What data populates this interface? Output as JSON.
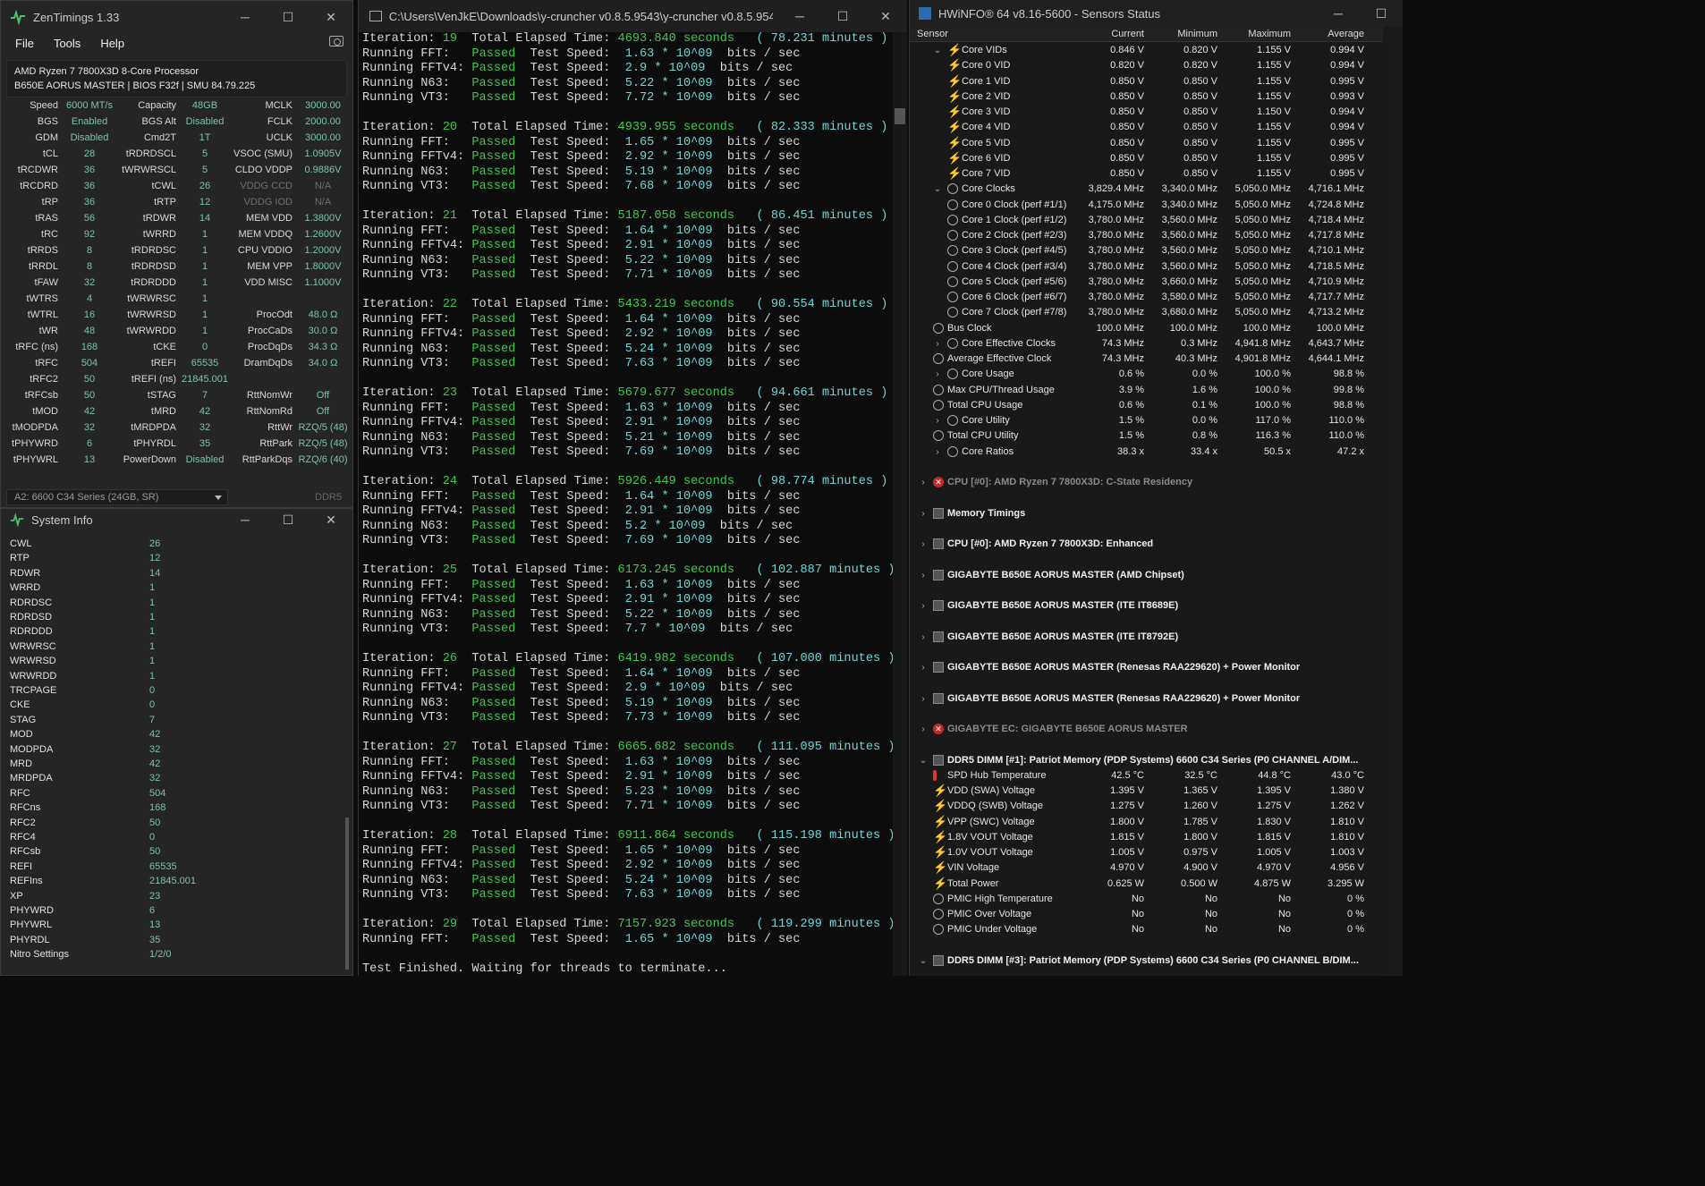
{
  "zentimings": {
    "title": "ZenTimings 1.33",
    "menu": [
      "File",
      "Tools",
      "Help"
    ],
    "cpu_name": "AMD Ryzen 7 7800X3D 8-Core Processor",
    "board": "B650E AORUS MASTER | BIOS F32f | SMU 84.79.225",
    "rows": [
      [
        [
          "Speed",
          "6000 MT/s"
        ],
        [
          "Capacity",
          "48GB"
        ],
        [
          "MCLK",
          "3000.00"
        ]
      ],
      [
        [
          "BGS",
          "Enabled"
        ],
        [
          "BGS Alt",
          "Disabled"
        ],
        [
          "FCLK",
          "2000.00"
        ]
      ],
      [
        [
          "GDM",
          "Disabled"
        ],
        [
          "Cmd2T",
          "1T"
        ],
        [
          "UCLK",
          "3000.00"
        ]
      ],
      [
        [
          "tCL",
          "28"
        ],
        [
          "tRDRDSCL",
          "5"
        ],
        [
          "VSOC (SMU)",
          "1.0905V"
        ]
      ],
      [
        [
          "tRCDWR",
          "36"
        ],
        [
          "tWRWRSCL",
          "5"
        ],
        [
          "CLDO VDDP",
          "0.9886V"
        ]
      ],
      [
        [
          "tRCDRD",
          "36"
        ],
        [
          "tCWL",
          "26"
        ],
        [
          "VDDG CCD",
          "N/A"
        ]
      ],
      [
        [
          "tRP",
          "36"
        ],
        [
          "tRTP",
          "12"
        ],
        [
          "VDDG IOD",
          "N/A"
        ]
      ],
      [
        [
          "tRAS",
          "56"
        ],
        [
          "tRDWR",
          "14"
        ],
        [
          "MEM VDD",
          "1.3800V"
        ]
      ],
      [
        [
          "tRC",
          "92"
        ],
        [
          "tWRRD",
          "1"
        ],
        [
          "MEM VDDQ",
          "1.2600V"
        ]
      ],
      [
        [
          "tRRDS",
          "8"
        ],
        [
          "tRDRDSC",
          "1"
        ],
        [
          "CPU VDDIO",
          "1.2000V"
        ]
      ],
      [
        [
          "tRRDL",
          "8"
        ],
        [
          "tRDRDSD",
          "1"
        ],
        [
          "MEM VPP",
          "1.8000V"
        ]
      ],
      [
        [
          "tFAW",
          "32"
        ],
        [
          "tRDRDDD",
          "1"
        ],
        [
          "VDD MISC",
          "1.1000V"
        ]
      ],
      [
        [
          "tWTRS",
          "4"
        ],
        [
          "tWRWRSC",
          "1"
        ],
        [
          "",
          ""
        ]
      ],
      [
        [
          "tWTRL",
          "16"
        ],
        [
          "tWRWRSD",
          "1"
        ],
        [
          "ProcOdt",
          "48.0 Ω"
        ]
      ],
      [
        [
          "tWR",
          "48"
        ],
        [
          "tWRWRDD",
          "1"
        ],
        [
          "ProcCaDs",
          "30.0 Ω"
        ]
      ],
      [
        [
          "tRFC (ns)",
          "168"
        ],
        [
          "tCKE",
          "0"
        ],
        [
          "ProcDqDs",
          "34.3 Ω"
        ]
      ],
      [
        [
          "tRFC",
          "504"
        ],
        [
          "tREFI",
          "65535"
        ],
        [
          "DramDqDs",
          "34.0 Ω"
        ]
      ],
      [
        [
          "tRFC2",
          "50"
        ],
        [
          "tREFI (ns)",
          "21845.001"
        ],
        [
          "",
          ""
        ]
      ],
      [
        [
          "tRFCsb",
          "50"
        ],
        [
          "tSTAG",
          "7"
        ],
        [
          "RttNomWr",
          "Off"
        ]
      ],
      [
        [
          "tMOD",
          "42"
        ],
        [
          "tMRD",
          "42"
        ],
        [
          "RttNomRd",
          "Off"
        ]
      ],
      [
        [
          "tMODPDA",
          "32"
        ],
        [
          "tMRDPDA",
          "32"
        ],
        [
          "RttWr",
          "RZQ/5 (48)"
        ]
      ],
      [
        [
          "tPHYWRD",
          "6"
        ],
        [
          "tPHYRDL",
          "35"
        ],
        [
          "RttPark",
          "RZQ/5 (48)"
        ]
      ],
      [
        [
          "tPHYWRL",
          "13"
        ],
        [
          "PowerDown",
          "Disabled"
        ],
        [
          "RttParkDqs",
          "RZQ/6 (40)"
        ]
      ]
    ],
    "dimm_select": "A2: 6600 C34 Series (24GB, SR)",
    "ddr_label": "DDR5"
  },
  "sysinfo": {
    "title": "System Info",
    "rows": [
      [
        "CWL",
        "26"
      ],
      [
        "RTP",
        "12"
      ],
      [
        "RDWR",
        "14"
      ],
      [
        "WRRD",
        "1"
      ],
      [
        "RDRDSC",
        "1"
      ],
      [
        "RDRDSD",
        "1"
      ],
      [
        "RDRDDD",
        "1"
      ],
      [
        "WRWRSC",
        "1"
      ],
      [
        "WRWRSD",
        "1"
      ],
      [
        "WRWRDD",
        "1"
      ],
      [
        "TRCPAGE",
        "0"
      ],
      [
        "CKE",
        "0"
      ],
      [
        "STAG",
        "7"
      ],
      [
        "MOD",
        "42"
      ],
      [
        "MODPDA",
        "32"
      ],
      [
        "MRD",
        "42"
      ],
      [
        "MRDPDA",
        "32"
      ],
      [
        "RFC",
        "504"
      ],
      [
        "RFCns",
        "168"
      ],
      [
        "RFC2",
        "50"
      ],
      [
        "RFC4",
        "0"
      ],
      [
        "RFCsb",
        "50"
      ],
      [
        "REFI",
        "65535"
      ],
      [
        "REFIns",
        "21845.001"
      ],
      [
        "XP",
        "23"
      ],
      [
        "PHYWRD",
        "6"
      ],
      [
        "PHYWRL",
        "13"
      ],
      [
        "PHYRDL",
        "35"
      ],
      [
        "Nitro Settings",
        "1/2/0"
      ]
    ]
  },
  "console": {
    "title": "C:\\Users\\VenJkE\\Downloads\\y-cruncher v0.8.5.9543\\y-cruncher v0.8.5.9543\\y-c...",
    "first_iteration": {
      "n": "19",
      "secs": "4693.840",
      "mins": "78.231",
      "speeds": [
        "1.63",
        "2.9",
        "5.22",
        "7.72"
      ]
    },
    "iterations": [
      {
        "n": "20",
        "secs": "4939.955",
        "mins": "82.333",
        "speeds": [
          "1.65",
          "2.92",
          "5.19",
          "7.68"
        ]
      },
      {
        "n": "21",
        "secs": "5187.058",
        "mins": "86.451",
        "speeds": [
          "1.64",
          "2.91",
          "5.22",
          "7.71"
        ]
      },
      {
        "n": "22",
        "secs": "5433.219",
        "mins": "90.554",
        "speeds": [
          "1.64",
          "2.92",
          "5.24",
          "7.63"
        ]
      },
      {
        "n": "23",
        "secs": "5679.677",
        "mins": "94.661",
        "speeds": [
          "1.63",
          "2.91",
          "5.21",
          "7.69"
        ]
      },
      {
        "n": "24",
        "secs": "5926.449",
        "mins": "98.774",
        "speeds": [
          "1.64",
          "2.91",
          "5.2",
          "7.69"
        ]
      },
      {
        "n": "25",
        "secs": "6173.245",
        "mins": "102.887",
        "speeds": [
          "1.63",
          "2.91",
          "5.22",
          "7.7"
        ]
      },
      {
        "n": "26",
        "secs": "6419.982",
        "mins": "107.000",
        "speeds": [
          "1.64",
          "2.9",
          "5.19",
          "7.73"
        ]
      },
      {
        "n": "27",
        "secs": "6665.682",
        "mins": "111.095",
        "speeds": [
          "1.63",
          "2.91",
          "5.23",
          "7.71"
        ]
      },
      {
        "n": "28",
        "secs": "6911.864",
        "mins": "115.198",
        "speeds": [
          "1.65",
          "2.92",
          "5.24",
          "7.63"
        ]
      }
    ],
    "last_iteration": {
      "n": "29",
      "secs": "7157.923",
      "mins": "119.299",
      "speeds": [
        "1.65"
      ]
    },
    "tests": [
      "FFT",
      "FFTv4",
      "N63",
      "VT3"
    ],
    "iter_label": "Iteration:",
    "elapsed_label": "Total Elapsed Time:",
    "seconds_label": "seconds",
    "minutes_label": "minutes",
    "running_label": "Running",
    "passed_label": "Passed",
    "speed_label": "Test Speed:",
    "exp_label": "* 10^09",
    "bits_label": "bits / sec",
    "footer": "Test Finished. Waiting for threads to terminate..."
  },
  "hwinfo": {
    "title": "HWiNFO® 64 v8.16-5600 - Sensors Status",
    "columns": [
      "Sensor",
      "Current",
      "Minimum",
      "Maximum",
      "Average"
    ],
    "rows": [
      {
        "t": "grp",
        "icon": "bolt",
        "exp": "v",
        "name": "Core VIDs",
        "v": [
          "0.846 V",
          "0.820 V",
          "1.155 V",
          "0.994 V"
        ]
      },
      {
        "t": "sub",
        "icon": "bolt",
        "name": "Core 0 VID",
        "v": [
          "0.820 V",
          "0.820 V",
          "1.155 V",
          "0.994 V"
        ]
      },
      {
        "t": "sub",
        "icon": "bolt",
        "name": "Core 1 VID",
        "v": [
          "0.850 V",
          "0.850 V",
          "1.155 V",
          "0.995 V"
        ]
      },
      {
        "t": "sub",
        "icon": "bolt",
        "name": "Core 2 VID",
        "v": [
          "0.850 V",
          "0.850 V",
          "1.155 V",
          "0.993 V"
        ]
      },
      {
        "t": "sub",
        "icon": "bolt",
        "name": "Core 3 VID",
        "v": [
          "0.850 V",
          "0.850 V",
          "1.150 V",
          "0.994 V"
        ]
      },
      {
        "t": "sub",
        "icon": "bolt",
        "name": "Core 4 VID",
        "v": [
          "0.850 V",
          "0.850 V",
          "1.155 V",
          "0.994 V"
        ]
      },
      {
        "t": "sub",
        "icon": "bolt",
        "name": "Core 5 VID",
        "v": [
          "0.850 V",
          "0.850 V",
          "1.155 V",
          "0.995 V"
        ]
      },
      {
        "t": "sub",
        "icon": "bolt",
        "name": "Core 6 VID",
        "v": [
          "0.850 V",
          "0.850 V",
          "1.155 V",
          "0.995 V"
        ]
      },
      {
        "t": "sub",
        "icon": "bolt",
        "name": "Core 7 VID",
        "v": [
          "0.850 V",
          "0.850 V",
          "1.155 V",
          "0.995 V"
        ]
      },
      {
        "t": "grp",
        "icon": "clock",
        "exp": "v",
        "name": "Core Clocks",
        "v": [
          "3,829.4 MHz",
          "3,340.0 MHz",
          "5,050.0 MHz",
          "4,716.1 MHz"
        ]
      },
      {
        "t": "sub",
        "icon": "clock",
        "name": "Core 0 Clock (perf #1/1)",
        "v": [
          "4,175.0 MHz",
          "3,340.0 MHz",
          "5,050.0 MHz",
          "4,724.8 MHz"
        ]
      },
      {
        "t": "sub",
        "icon": "clock",
        "name": "Core 1 Clock (perf #1/2)",
        "v": [
          "3,780.0 MHz",
          "3,560.0 MHz",
          "5,050.0 MHz",
          "4,718.4 MHz"
        ]
      },
      {
        "t": "sub",
        "icon": "clock",
        "name": "Core 2 Clock (perf #2/3)",
        "v": [
          "3,780.0 MHz",
          "3,560.0 MHz",
          "5,050.0 MHz",
          "4,717.8 MHz"
        ]
      },
      {
        "t": "sub",
        "icon": "clock",
        "name": "Core 3 Clock (perf #4/5)",
        "v": [
          "3,780.0 MHz",
          "3,560.0 MHz",
          "5,050.0 MHz",
          "4,710.1 MHz"
        ]
      },
      {
        "t": "sub",
        "icon": "clock",
        "name": "Core 4 Clock (perf #3/4)",
        "v": [
          "3,780.0 MHz",
          "3,560.0 MHz",
          "5,050.0 MHz",
          "4,718.5 MHz"
        ]
      },
      {
        "t": "sub",
        "icon": "clock",
        "name": "Core 5 Clock (perf #5/6)",
        "v": [
          "3,780.0 MHz",
          "3,660.0 MHz",
          "5,050.0 MHz",
          "4,710.9 MHz"
        ]
      },
      {
        "t": "sub",
        "icon": "clock",
        "name": "Core 6 Clock (perf #6/7)",
        "v": [
          "3,780.0 MHz",
          "3,580.0 MHz",
          "5,050.0 MHz",
          "4,717.7 MHz"
        ]
      },
      {
        "t": "sub",
        "icon": "clock",
        "name": "Core 7 Clock (perf #7/8)",
        "v": [
          "3,780.0 MHz",
          "3,680.0 MHz",
          "5,050.0 MHz",
          "4,713.2 MHz"
        ]
      },
      {
        "t": "item",
        "icon": "clock",
        "name": "Bus Clock",
        "v": [
          "100.0 MHz",
          "100.0 MHz",
          "100.0 MHz",
          "100.0 MHz"
        ]
      },
      {
        "t": "grp",
        "icon": "clock",
        "exp": ">",
        "name": "Core Effective Clocks",
        "v": [
          "74.3 MHz",
          "0.3 MHz",
          "4,941.8 MHz",
          "4,643.7 MHz"
        ]
      },
      {
        "t": "item",
        "icon": "clock",
        "name": "Average Effective Clock",
        "v": [
          "74.3 MHz",
          "40.3 MHz",
          "4,901.8 MHz",
          "4,644.1 MHz"
        ]
      },
      {
        "t": "grp",
        "icon": "clock",
        "exp": ">",
        "name": "Core Usage",
        "v": [
          "0.6 %",
          "0.0 %",
          "100.0 %",
          "98.8 %"
        ]
      },
      {
        "t": "item",
        "icon": "clock",
        "name": "Max CPU/Thread Usage",
        "v": [
          "3.9 %",
          "1.6 %",
          "100.0 %",
          "99.8 %"
        ]
      },
      {
        "t": "item",
        "icon": "clock",
        "name": "Total CPU Usage",
        "v": [
          "0.6 %",
          "0.1 %",
          "100.0 %",
          "98.8 %"
        ]
      },
      {
        "t": "grp",
        "icon": "clock",
        "exp": ">",
        "name": "Core Utility",
        "v": [
          "1.5 %",
          "0.0 %",
          "117.0 %",
          "110.0 %"
        ]
      },
      {
        "t": "item",
        "icon": "clock",
        "name": "Total CPU Utility",
        "v": [
          "1.5 %",
          "0.8 %",
          "116.3 %",
          "110.0 %"
        ]
      },
      {
        "t": "grp",
        "icon": "clock",
        "exp": ">",
        "name": "Core Ratios",
        "v": [
          "38.3 x",
          "33.4 x",
          "50.5 x",
          "47.2 x"
        ]
      }
    ],
    "sections": [
      {
        "icon": "err",
        "dim": true,
        "name": "CPU [#0]: AMD Ryzen 7 7800X3D: C-State Residency"
      },
      {
        "icon": "chip",
        "name": "Memory Timings"
      },
      {
        "icon": "chip",
        "name": "CPU [#0]: AMD Ryzen 7 7800X3D: Enhanced"
      },
      {
        "icon": "chip",
        "name": "GIGABYTE B650E AORUS MASTER (AMD Chipset)"
      },
      {
        "icon": "chip",
        "name": "GIGABYTE B650E AORUS MASTER (ITE IT8689E)"
      },
      {
        "icon": "chip",
        "name": "GIGABYTE B650E AORUS MASTER (ITE IT8792E)"
      },
      {
        "icon": "chip",
        "name": "GIGABYTE B650E AORUS MASTER (Renesas RAA229620) + Power Monitor"
      },
      {
        "icon": "chip",
        "name": "GIGABYTE B650E AORUS MASTER (Renesas RAA229620) + Power Monitor"
      },
      {
        "icon": "err",
        "dim": true,
        "name": "GIGABYTE EC: GIGABYTE B650E AORUS MASTER"
      }
    ],
    "dimm1": "DDR5 DIMM [#1]: Patriot Memory (PDP Systems) 6600 C34 Series (P0 CHANNEL A/DIM...",
    "dimm_rows": [
      {
        "icon": "therm",
        "name": "SPD Hub Temperature",
        "v": [
          "42.5 °C",
          "32.5 °C",
          "44.8 °C",
          "43.0 °C"
        ]
      },
      {
        "icon": "bolt",
        "name": "VDD (SWA) Voltage",
        "v": [
          "1.395 V",
          "1.365 V",
          "1.395 V",
          "1.380 V"
        ]
      },
      {
        "icon": "bolt",
        "name": "VDDQ (SWB) Voltage",
        "v": [
          "1.275 V",
          "1.260 V",
          "1.275 V",
          "1.262 V"
        ]
      },
      {
        "icon": "bolt",
        "name": "VPP (SWC) Voltage",
        "v": [
          "1.800 V",
          "1.785 V",
          "1.830 V",
          "1.810 V"
        ]
      },
      {
        "icon": "bolt",
        "name": "1.8V VOUT Voltage",
        "v": [
          "1.815 V",
          "1.800 V",
          "1.815 V",
          "1.810 V"
        ]
      },
      {
        "icon": "bolt",
        "name": "1.0V VOUT Voltage",
        "v": [
          "1.005 V",
          "0.975 V",
          "1.005 V",
          "1.003 V"
        ]
      },
      {
        "icon": "bolt",
        "name": "VIN Voltage",
        "v": [
          "4.970 V",
          "4.900 V",
          "4.970 V",
          "4.956 V"
        ]
      },
      {
        "icon": "bolt",
        "name": "Total Power",
        "v": [
          "0.625 W",
          "0.500 W",
          "4.875 W",
          "3.295 W"
        ]
      },
      {
        "icon": "clock",
        "name": "PMIC High Temperature",
        "v": [
          "No",
          "No",
          "No",
          "0 %"
        ]
      },
      {
        "icon": "clock",
        "name": "PMIC Over Voltage",
        "v": [
          "No",
          "No",
          "No",
          "0 %"
        ]
      },
      {
        "icon": "clock",
        "name": "PMIC Under Voltage",
        "v": [
          "No",
          "No",
          "No",
          "0 %"
        ]
      }
    ],
    "dimm3": "DDR5 DIMM [#3]: Patriot Memory (PDP Systems) 6600 C34 Series (P0 CHANNEL B/DIM..."
  }
}
